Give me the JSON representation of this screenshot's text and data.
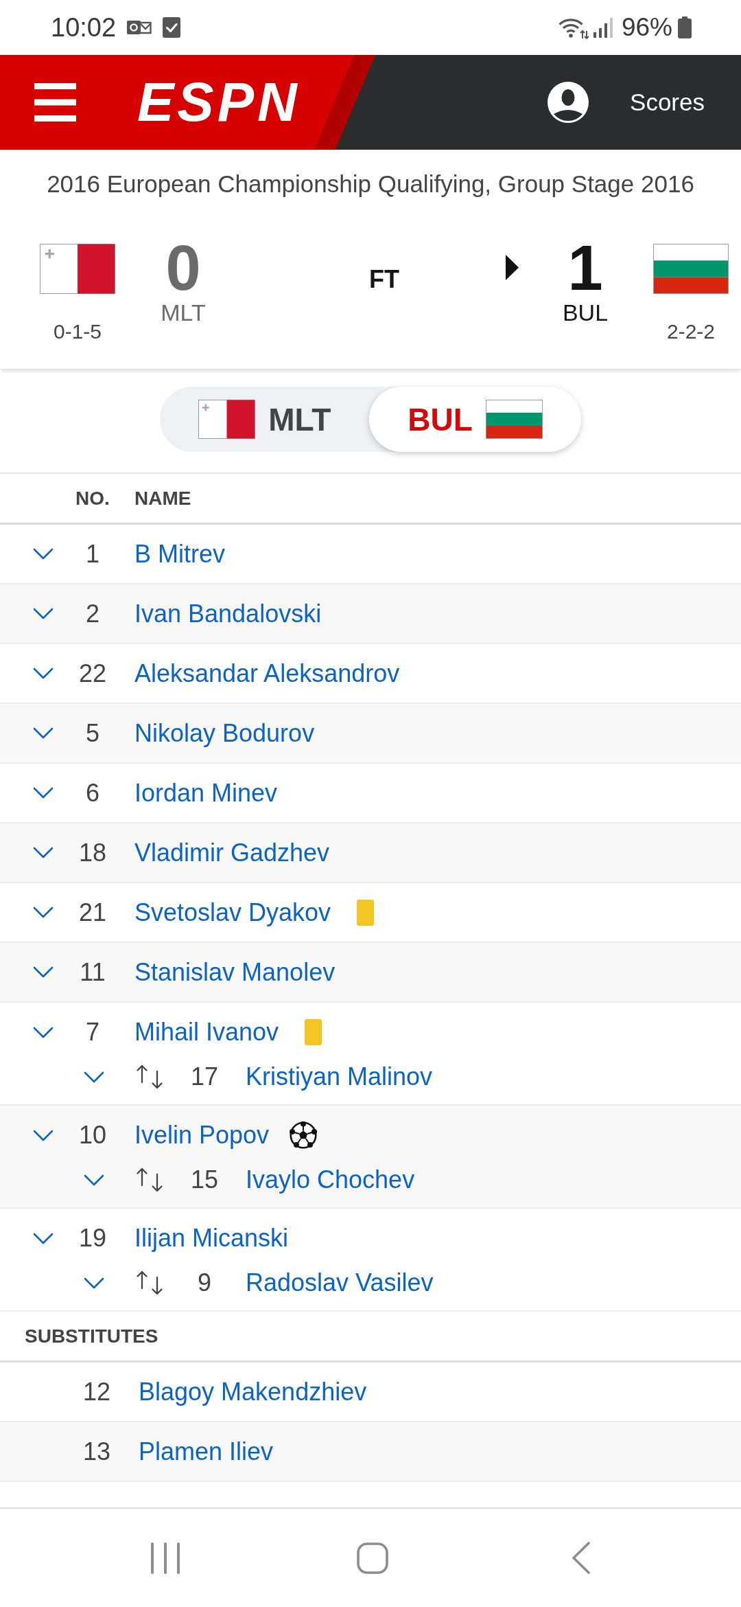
{
  "status_bar": {
    "time": "10:02",
    "battery": "96%"
  },
  "header": {
    "logo": "ESPN",
    "link": "Scores"
  },
  "match": {
    "competition": "2016 European Championship Qualifying, Group Stage 2016",
    "status": "FT",
    "teams": [
      {
        "flag": {
          "kind": "malta"
        },
        "score": "0",
        "abbreviation": "MLT",
        "record": "0-1-5",
        "winner": false
      },
      {
        "flag": {
          "kind": "bulgaria"
        },
        "score": "1",
        "abbreviation": "BUL",
        "record": "2-2-2",
        "winner": true
      }
    ]
  },
  "team_toggle": [
    {
      "label": "MLT",
      "flag": {
        "kind": "malta"
      },
      "selected": false
    },
    {
      "label": "BUL",
      "flag": {
        "kind": "bulgaria"
      },
      "selected": true
    }
  ],
  "lineup": {
    "columns": [
      "NO.",
      "NAME"
    ],
    "starters": [
      {
        "number": "1",
        "name": "B Mitrev",
        "expanded": false
      },
      {
        "number": "2",
        "name": "Ivan Bandalovski",
        "expanded": false
      },
      {
        "number": "22",
        "name": "Aleksandar Aleksandrov",
        "expanded": false
      },
      {
        "number": "5",
        "name": "Nikolay Bodurov",
        "expanded": false
      },
      {
        "number": "6",
        "name": "Iordan Minev",
        "expanded": false
      },
      {
        "number": "18",
        "name": "Vladimir Gadzhev",
        "expanded": false
      },
      {
        "number": "21",
        "name": "Svetoslav Dyakov",
        "expanded": false,
        "events": [
          {
            "kind": "yellow_card"
          }
        ]
      },
      {
        "number": "11",
        "name": "Stanislav Manolev",
        "expanded": false
      },
      {
        "number": "7",
        "name": "Mihail Ivanov",
        "expanded": false,
        "events": [
          {
            "kind": "yellow_card"
          }
        ],
        "replaced_by": {
          "number": "17",
          "name": "Kristiyan Malinov",
          "expanded": false
        }
      },
      {
        "number": "10",
        "name": "Ivelin Popov",
        "expanded": false,
        "events": [
          {
            "kind": "goal"
          }
        ],
        "replaced_by": {
          "number": "15",
          "name": "Ivaylo Chochev",
          "expanded": false
        }
      },
      {
        "number": "19",
        "name": "Ilijan Micanski",
        "expanded": false,
        "replaced_by": {
          "number": "9",
          "name": "Radoslav Vasilev",
          "expanded": false
        }
      }
    ],
    "substitutes_title": "SUBSTITUTES",
    "substitutes": [
      {
        "number": "12",
        "name": "Blagoy Makendzhiev"
      },
      {
        "number": "13",
        "name": "Plamen Iliev"
      }
    ]
  }
}
